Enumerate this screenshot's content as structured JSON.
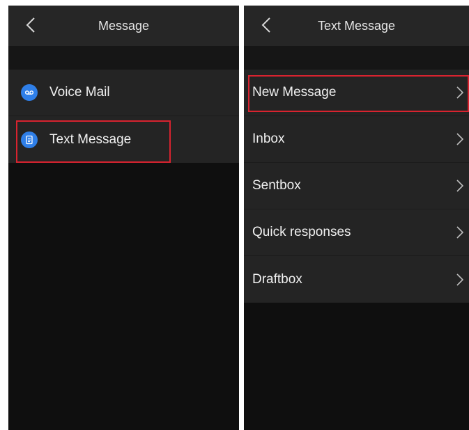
{
  "left_screen": {
    "title": "Message",
    "items": [
      {
        "label": "Voice Mail",
        "icon": "voicemail-icon"
      },
      {
        "label": "Text Message",
        "icon": "document-icon"
      }
    ]
  },
  "right_screen": {
    "title": "Text Message",
    "items": [
      {
        "label": "New Message"
      },
      {
        "label": "Inbox"
      },
      {
        "label": "Sentbox"
      },
      {
        "label": "Quick responses"
      },
      {
        "label": "Draftbox"
      }
    ]
  },
  "colors": {
    "accent": "#2f7fe8",
    "highlight": "#d8232f",
    "titlebar": "#262626",
    "list_bg": "#242424",
    "screen_bg": "#0f0f0f"
  }
}
